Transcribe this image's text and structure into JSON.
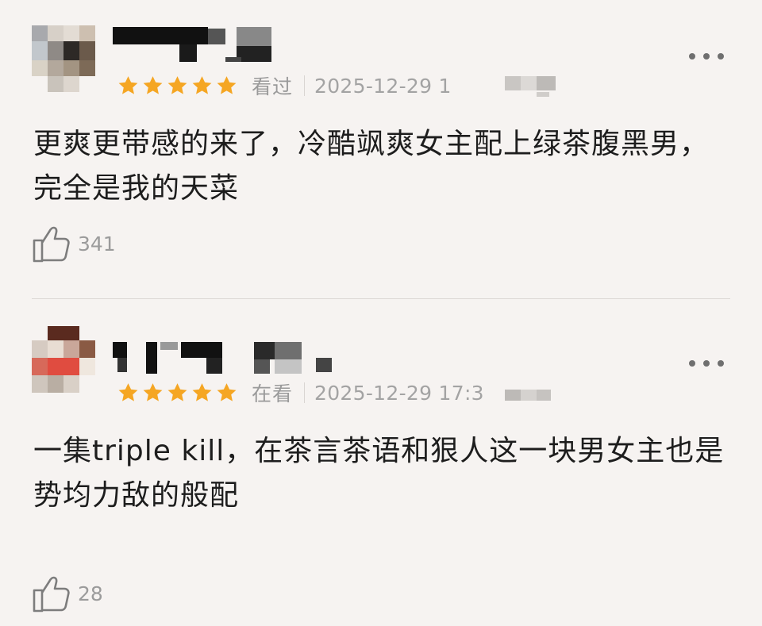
{
  "comments": [
    {
      "status": "看过",
      "time": "2025-12-29 1",
      "rating": 5,
      "text": "更爽更带感的来了，冷酷飒爽女主配上绿茶腹黑男，完全是我的天菜",
      "likes": "341"
    },
    {
      "status": "在看",
      "time": "2025-12-29 17:3",
      "rating": 5,
      "text": "一集triple kill，在茶言茶语和狠人这一块男女主也是势均力敌的般配",
      "likes": "28"
    }
  ],
  "colors": {
    "star": "#f5a623",
    "background": "#f6f3f1",
    "muted": "#9b9b9b"
  },
  "icons": {
    "more": "more-dots-icon",
    "like": "thumbs-up-icon",
    "star": "star-icon"
  }
}
